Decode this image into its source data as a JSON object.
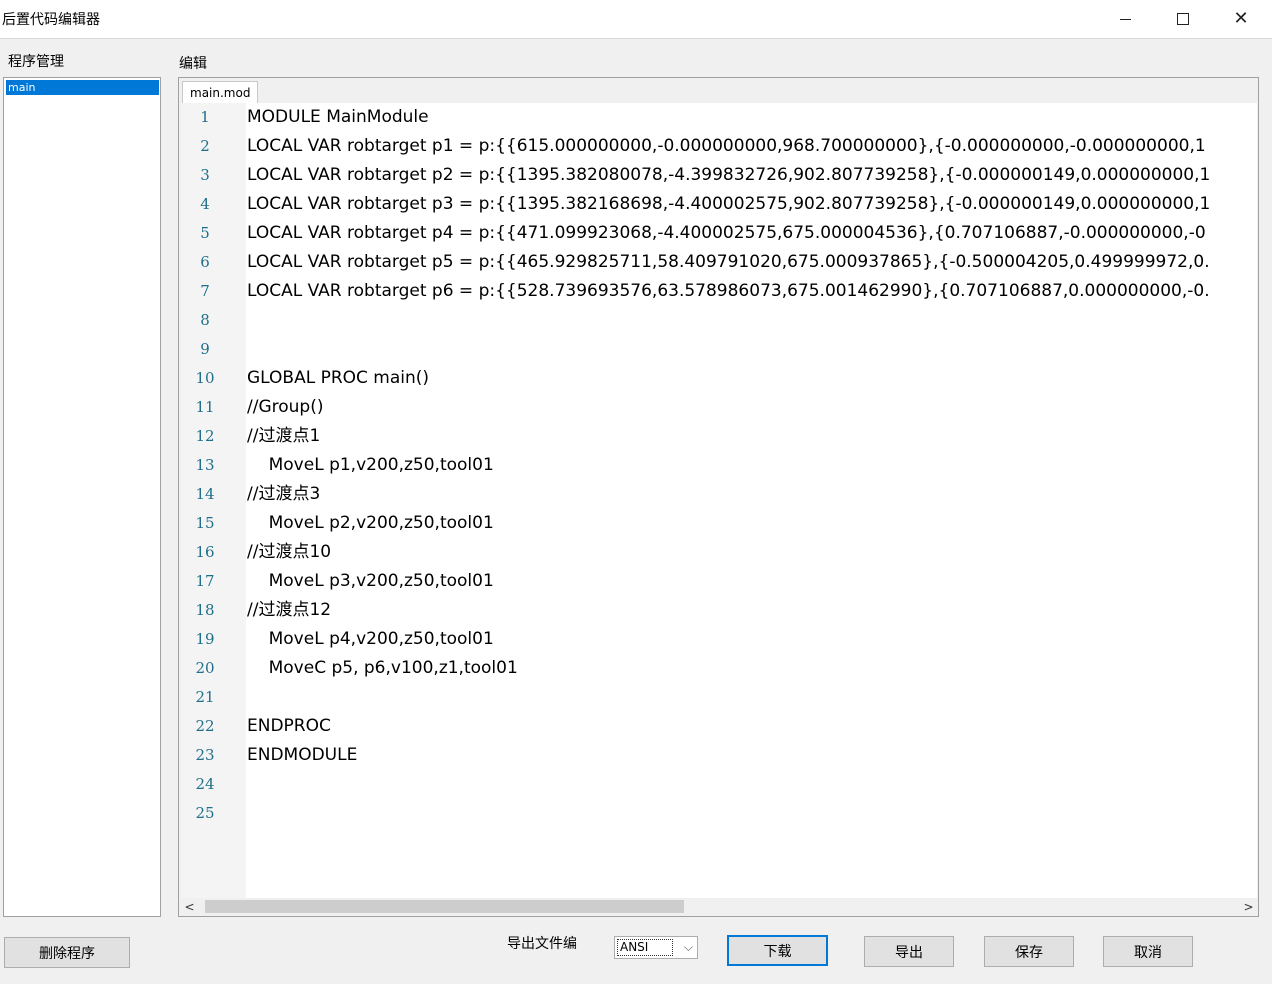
{
  "window": {
    "title": "后置代码编辑器",
    "minimize_icon": "minimize-icon",
    "maximize_icon": "maximize-icon",
    "close_glyph": "✕"
  },
  "sidebar": {
    "label": "程序管理",
    "items": [
      {
        "label": "main",
        "selected": true
      }
    ],
    "selected_color": "#0078d7"
  },
  "editor": {
    "label": "编辑",
    "tab": "main.mod",
    "lines": [
      {
        "n": "1",
        "text": "MODULE MainModule"
      },
      {
        "n": "2",
        "text": "LOCAL VAR robtarget p1 = p:{{615.000000000,-0.000000000,968.700000000},{-0.000000000,-0.000000000,1"
      },
      {
        "n": "3",
        "text": "LOCAL VAR robtarget p2 = p:{{1395.382080078,-4.399832726,902.807739258},{-0.000000149,0.000000000,1"
      },
      {
        "n": "4",
        "text": "LOCAL VAR robtarget p3 = p:{{1395.382168698,-4.400002575,902.807739258},{-0.000000149,0.000000000,1"
      },
      {
        "n": "5",
        "text": "LOCAL VAR robtarget p4 = p:{{471.099923068,-4.400002575,675.000004536},{0.707106887,-0.000000000,-0"
      },
      {
        "n": "6",
        "text": "LOCAL VAR robtarget p5 = p:{{465.929825711,58.409791020,675.000937865},{-0.500004205,0.499999972,0."
      },
      {
        "n": "7",
        "text": "LOCAL VAR robtarget p6 = p:{{528.739693576,63.578986073,675.001462990},{0.707106887,0.000000000,-0."
      },
      {
        "n": "8",
        "text": ""
      },
      {
        "n": "9",
        "text": ""
      },
      {
        "n": "10",
        "text": "GLOBAL PROC main()"
      },
      {
        "n": "11",
        "text": "//Group()"
      },
      {
        "n": "12",
        "text": "//过渡点1"
      },
      {
        "n": "13",
        "text": "    MoveL p1,v200,z50,tool01"
      },
      {
        "n": "14",
        "text": "//过渡点3"
      },
      {
        "n": "15",
        "text": "    MoveL p2,v200,z50,tool01"
      },
      {
        "n": "16",
        "text": "//过渡点10"
      },
      {
        "n": "17",
        "text": "    MoveL p3,v200,z50,tool01"
      },
      {
        "n": "18",
        "text": "//过渡点12"
      },
      {
        "n": "19",
        "text": "    MoveL p4,v200,z50,tool01"
      },
      {
        "n": "20",
        "text": "    MoveC p5, p6,v100,z1,tool01"
      },
      {
        "n": "21",
        "text": ""
      },
      {
        "n": "22",
        "text": "ENDPROC"
      },
      {
        "n": "23",
        "text": "ENDMODULE"
      },
      {
        "n": "24",
        "text": ""
      },
      {
        "n": "25",
        "text": ""
      }
    ],
    "scroll_left_glyph": "<",
    "scroll_right_glyph": ">"
  },
  "footer": {
    "delete_label": "删除程序",
    "encoding_label": "导出文件编",
    "encoding_value": "ANSI",
    "chevron_glyph": "⌵",
    "download_label": "下载",
    "export_label": "导出",
    "save_label": "保存",
    "cancel_label": "取消"
  }
}
